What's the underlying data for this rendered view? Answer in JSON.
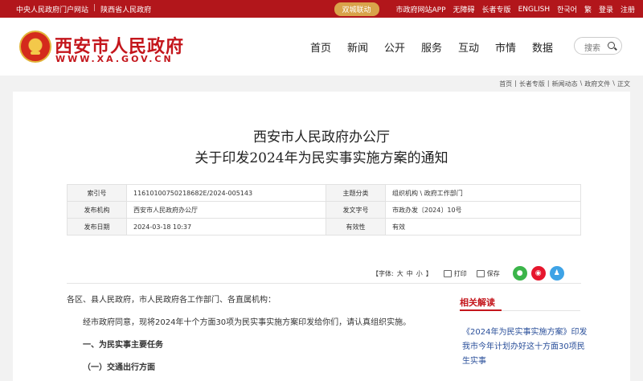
{
  "topbar": {
    "left_links": [
      "中央人民政府门户网站",
      "陕西省人民政府"
    ],
    "pill": "双城联动",
    "right_links": [
      "市政府网站APP",
      "无障碍",
      "长者专版",
      "ENGLISH",
      "한국어",
      "繁",
      "登录",
      "注册"
    ]
  },
  "header": {
    "title": "西安市人民政府",
    "subtitle": "WWW.XA.GOV.CN",
    "nav": [
      "首页",
      "新闻",
      "公开",
      "服务",
      "互动",
      "市情",
      "数据"
    ],
    "search_placeholder": "搜索"
  },
  "breadcrumb": [
    "首页",
    "|",
    "长者专版",
    "|",
    "新闻动态",
    "\\",
    "政府文件",
    "\\",
    "正文"
  ],
  "doc": {
    "title_line1": "西安市人民政府办公厅",
    "title_line2": "关于印发2024年为民实事实施方案的通知",
    "meta": [
      {
        "k1": "索引号",
        "v1": "11610100750218682E/2024-005143",
        "k2": "主题分类",
        "v2": "组织机构 \\ 政府工作部门"
      },
      {
        "k1": "发布机构",
        "v1": "西安市人民政府办公厅",
        "k2": "发文字号",
        "v2": "市政办发〔2024〕10号"
      },
      {
        "k1": "发布日期",
        "v1": "2024-03-18 10:37",
        "k2": "有效性",
        "v2": "有效"
      }
    ]
  },
  "tools": {
    "font_label": "【字体:",
    "font_sizes": [
      "大",
      "中",
      "小"
    ],
    "font_end": "】",
    "print": "打印",
    "save": "保存",
    "share_icons": [
      "wechat-icon",
      "weibo-icon",
      "qq-icon"
    ]
  },
  "body": {
    "p1": "各区、县人民政府，市人民政府各工作部门、各直属机构：",
    "p2": "经市政府同意，现将2024年十个方面30项为民实事实施方案印发给你们，请认真组织实施。",
    "h1": "一、为民实事主要任务",
    "h2": "（一）交通出行方面"
  },
  "sidebar": {
    "title": "相关解读",
    "link": "《2024年为民实事实施方案》印发 我市今年计划办好这十方面30项民生实事"
  },
  "colors": {
    "brand_red": "#b2161b",
    "pill_gold": "#d9a34a",
    "link_blue": "#2a4f9a"
  }
}
